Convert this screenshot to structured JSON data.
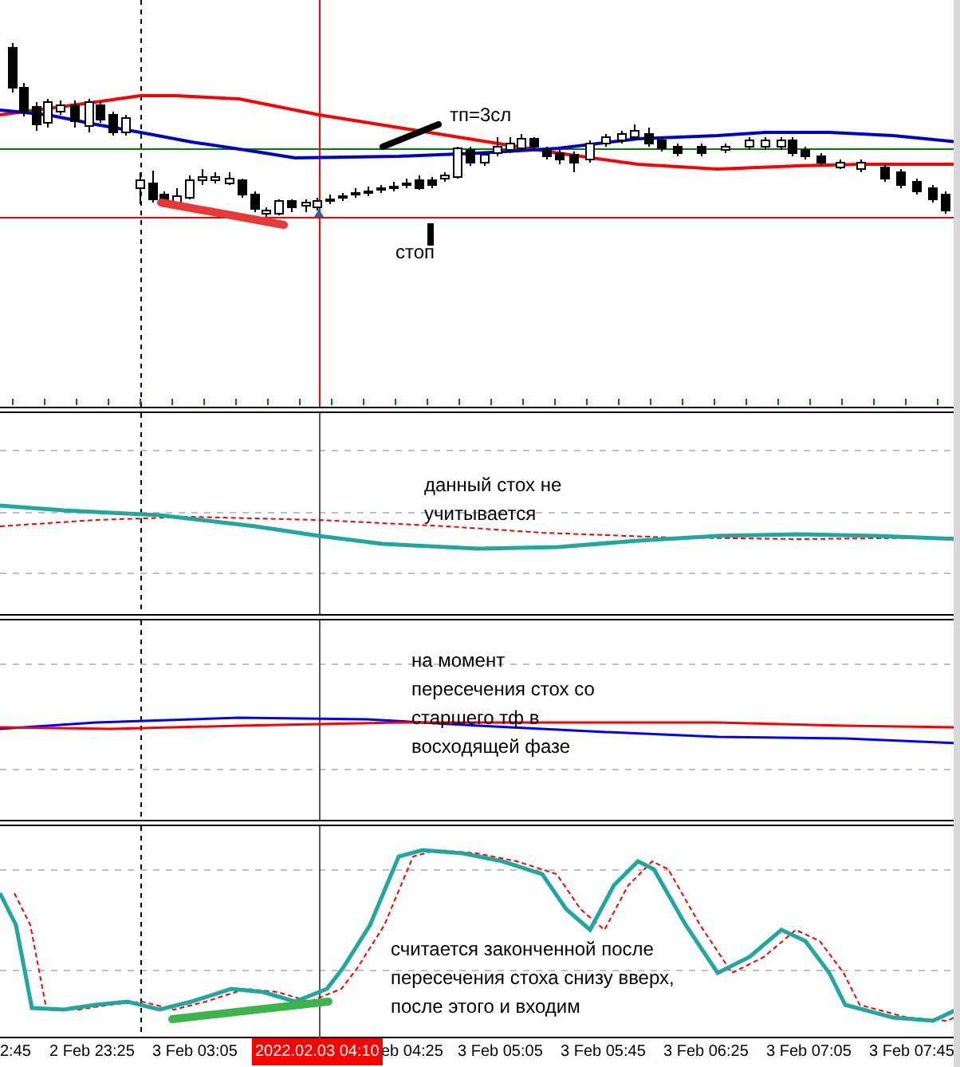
{
  "main_chart": {
    "annotations": [
      {
        "text": "тп=3сл",
        "kind": "take-profit"
      },
      {
        "text": "стоп",
        "kind": "stop"
      }
    ]
  },
  "stoch_panel_1": {
    "note": "данный стох не учитывается"
  },
  "stoch_panel_2": {
    "note": "на момент пересечения стох со старшего тф в восходящей фазе"
  },
  "stoch_panel_3": {
    "note": "считается законченной после пересечения стоха снизу вверх, после этого и входим"
  },
  "time_axis": {
    "labels": [
      "2:45",
      "2 Feb 23:25",
      "3 Feb 03:05",
      "eb 04:25",
      "3 Feb 05:05",
      "3 Feb 05:45",
      "3 Feb 06:25",
      "3 Feb 07:05",
      "3 Feb 07:45"
    ],
    "cursor_label": "2022.02.03 04:10"
  }
}
